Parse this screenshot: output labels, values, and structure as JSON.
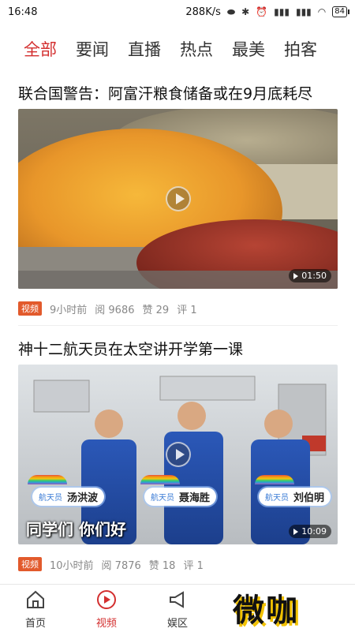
{
  "status_bar": {
    "time": "16:48",
    "speed": "288K/s",
    "battery": "84"
  },
  "tabs": [
    {
      "label": "全部",
      "active": true
    },
    {
      "label": "要闻",
      "active": false
    },
    {
      "label": "直播",
      "active": false
    },
    {
      "label": "热点",
      "active": false
    },
    {
      "label": "最美",
      "active": false
    },
    {
      "label": "拍客",
      "active": false
    }
  ],
  "articles": [
    {
      "title": "联合国警告：阿富汗粮食储备或在9月底耗尽",
      "duration": "01:50",
      "badge": "视频",
      "time_ago": "9小时前",
      "views": "阅 9686",
      "likes": "赞 29",
      "comments": "评 1"
    },
    {
      "title": "神十二航天员在太空讲开学第一课",
      "duration": "10:09",
      "badge": "视频",
      "time_ago": "10小时前",
      "views": "阅 7876",
      "likes": "赞 18",
      "comments": "评 1",
      "scene": {
        "role": "航天员",
        "names": [
          "汤洪波",
          "聂海胜",
          "刘伯明"
        ],
        "subtitle": "同学们 你们好"
      }
    }
  ],
  "bottom_nav": [
    {
      "label": "首页",
      "icon": "home-icon",
      "active": false
    },
    {
      "label": "视频",
      "icon": "play-circle-icon",
      "active": true
    },
    {
      "label": "娱区",
      "icon": "megaphone-icon",
      "active": false
    }
  ],
  "watermark": "微咖",
  "colors": {
    "accent": "#d32f2f",
    "badge": "#e25a2c"
  }
}
